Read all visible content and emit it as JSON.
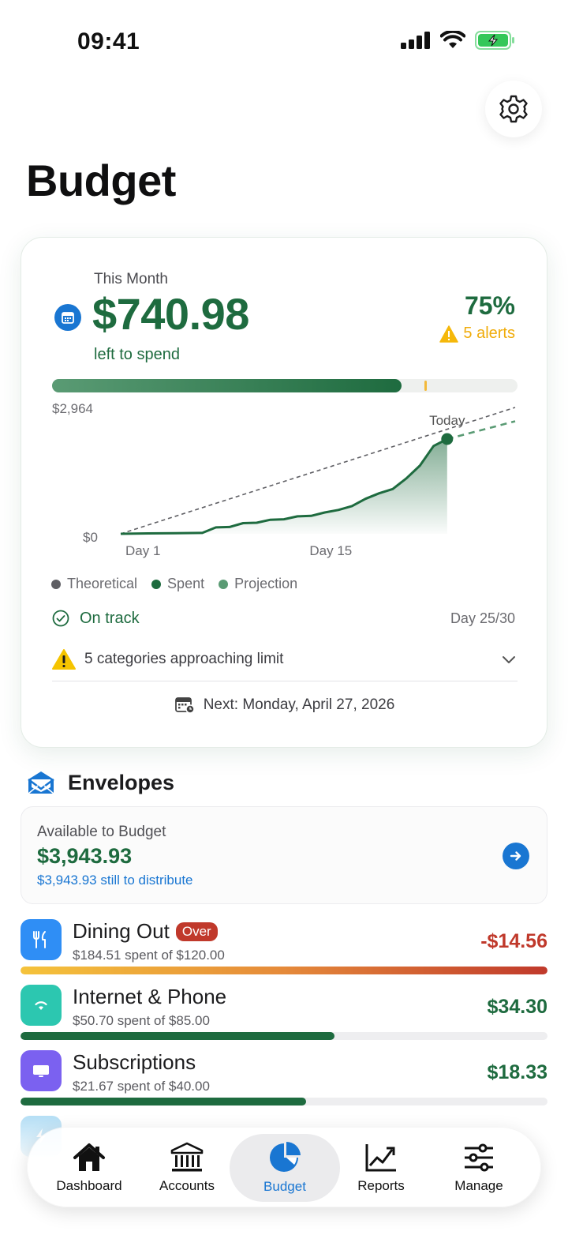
{
  "status": {
    "time": "09:41"
  },
  "page": {
    "title": "Budget"
  },
  "summary": {
    "month_label": "This Month",
    "amount_left": "$740.98",
    "left_label": "left to spend",
    "percent": "75%",
    "alerts": "5 alerts",
    "progress_fraction": 0.75,
    "threshold_fraction": 0.8,
    "status": "On track",
    "day_counter": "Day 25/30",
    "approaching": "5 categories approaching limit",
    "next": "Next: Monday, April 27, 2026"
  },
  "chart_data": {
    "type": "line",
    "y_tick_labels": [
      "$2,964",
      "$0"
    ],
    "ylim": [
      0,
      2964
    ],
    "x_tick_labels": [
      "Day 1",
      "Day 15"
    ],
    "xlim": [
      1,
      30
    ],
    "today_label": "Today",
    "today_day": 25,
    "series": [
      {
        "name": "Theoretical",
        "x": [
          1,
          30
        ],
        "values": [
          0,
          2964
        ]
      },
      {
        "name": "Spent",
        "x": [
          1,
          3,
          5,
          7,
          8,
          9,
          10,
          11,
          12,
          13,
          14,
          15,
          16,
          17,
          18,
          19,
          20,
          21,
          22,
          23,
          24,
          25
        ],
        "values": [
          0,
          10,
          15,
          20,
          150,
          160,
          250,
          260,
          330,
          340,
          410,
          420,
          500,
          560,
          650,
          820,
          950,
          1050,
          1300,
          1600,
          2060,
          2223
        ]
      },
      {
        "name": "Projection",
        "x": [
          25,
          30
        ],
        "values": [
          2223,
          2640
        ]
      }
    ],
    "legend": [
      {
        "name": "Theoretical",
        "color": "#5f5f64"
      },
      {
        "name": "Spent",
        "color": "#1e6b3f"
      },
      {
        "name": "Projection",
        "color": "#5a9b74"
      }
    ]
  },
  "envelopes": {
    "title": "Envelopes",
    "available": {
      "label": "Available to Budget",
      "amount": "$3,943.93",
      "sub": "$3,943.93 still to distribute"
    },
    "items": [
      {
        "name": "Dining Out",
        "badge": "Over",
        "sub": "$184.51 spent of $120.00",
        "value": "-$14.56",
        "value_color": "#c0392b",
        "progress": 1.0,
        "icon": "fork-knife-icon",
        "icon_color": "#2f8ef5"
      },
      {
        "name": "Internet & Phone",
        "sub": "$50.70 spent of $85.00",
        "value": "$34.30",
        "value_color": "#1e6b3f",
        "progress": 0.596,
        "icon": "wifi-icon",
        "icon_color": "#2cc7b0"
      },
      {
        "name": "Subscriptions",
        "sub": "$21.67 spent of $40.00",
        "value": "$18.33",
        "value_color": "#1e6b3f",
        "progress": 0.542,
        "icon": "tv-icon",
        "icon_color": "#7b61f0"
      }
    ]
  },
  "tabs": [
    {
      "label": "Dashboard",
      "icon": "house-icon"
    },
    {
      "label": "Accounts",
      "icon": "bank-icon"
    },
    {
      "label": "Budget",
      "icon": "pie-chart-icon",
      "active": true
    },
    {
      "label": "Reports",
      "icon": "trend-chart-icon"
    },
    {
      "label": "Manage",
      "icon": "sliders-icon"
    }
  ]
}
